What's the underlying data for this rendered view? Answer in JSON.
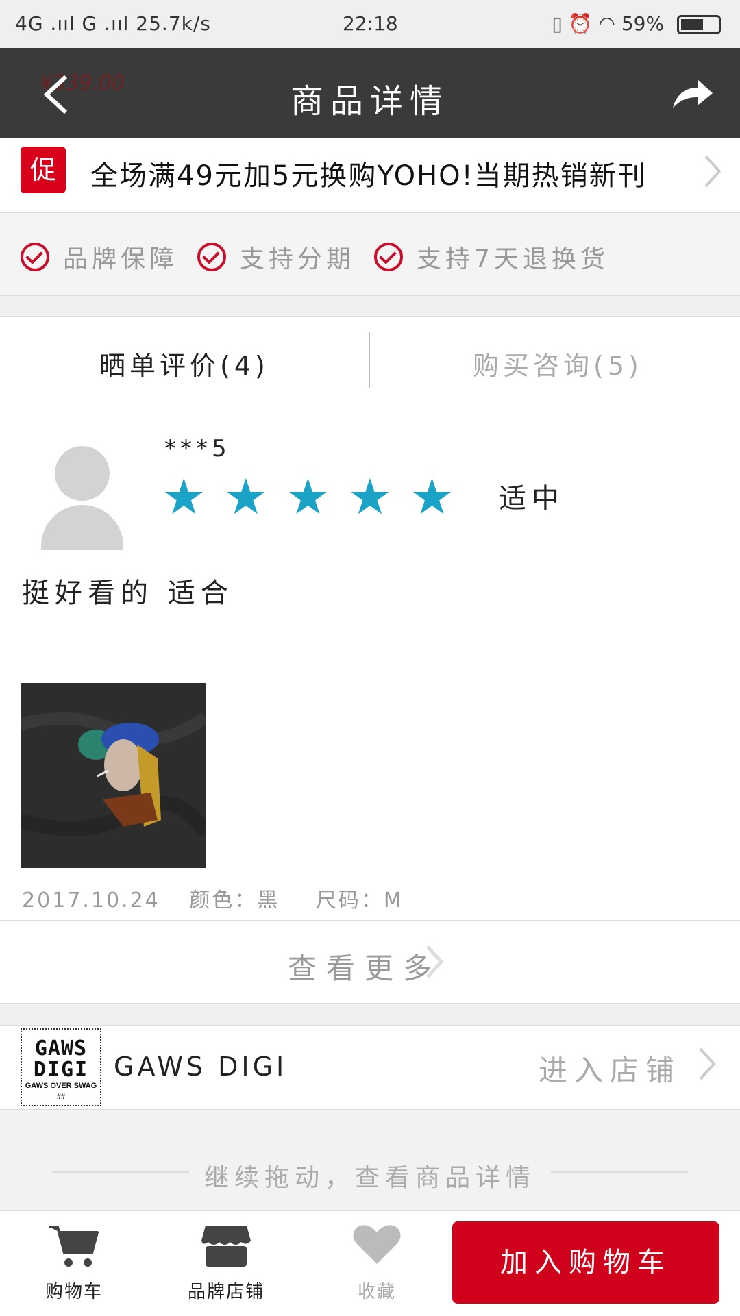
{
  "status_bar": {
    "left": "4G .ııl G .ııl 25.7k/s",
    "time": "22:18",
    "battery": "59%"
  },
  "navbar": {
    "title": "商品详情",
    "faded_price": "¥339.00"
  },
  "promo": {
    "badge": "促",
    "text": "全场满49元加5元换购YOHO!当期热销新刊"
  },
  "guarantees": [
    "品牌保障",
    "支持分期",
    "支持7天退换货"
  ],
  "tabs": {
    "reviews": "晒单评价(4)",
    "consult": "购买咨询(5)"
  },
  "review": {
    "username": "***5",
    "rating": 5,
    "fit": "适中",
    "text": "挺好看的 适合",
    "date": "2017.10.24",
    "color": "颜色：黑",
    "size": "尺码：M"
  },
  "view_more": "查看更多",
  "store": {
    "logo_line1": "GAWS",
    "logo_line2": "DIGI",
    "logo_line3": "GAWS OVER SWAG",
    "logo_line4": "##",
    "name": "GAWS DIGI",
    "enter": "进入店铺"
  },
  "hint": "继续拖动，查看商品详情",
  "bottom_bar": {
    "cart": "购物车",
    "brand_store": "品牌店铺",
    "favorite": "收藏",
    "add_to_cart": "加入购物车"
  },
  "colors": {
    "accent": "#d0021b",
    "star": "#1aa3c6",
    "navbar": "#3a3a3a"
  }
}
